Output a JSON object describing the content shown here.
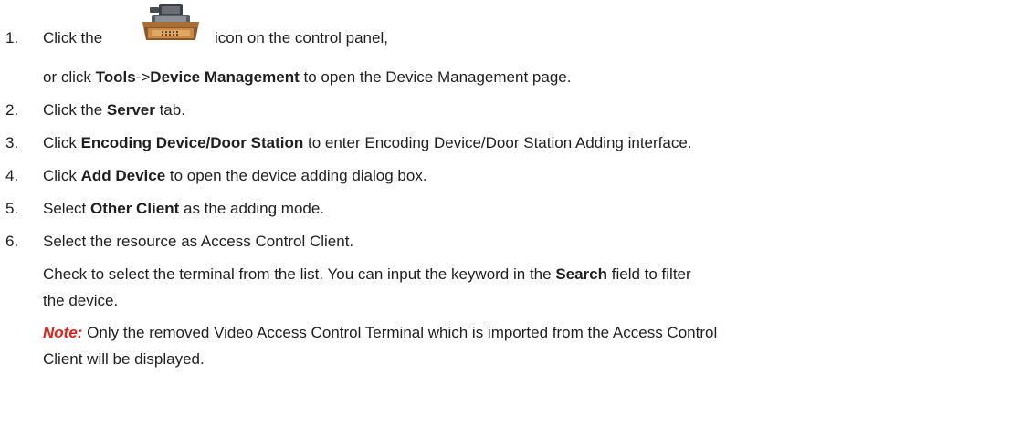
{
  "steps": [
    {
      "num": "1.",
      "pre": "Click the",
      "post": "icon on the control panel,",
      "cont_pre": "or click ",
      "cont_b1": "Tools",
      "cont_mid": "->",
      "cont_b2": "Device Management",
      "cont_post": " to open the Device Management page."
    },
    {
      "num": "2.",
      "pre": "Click the ",
      "bold": "Server",
      "post": " tab."
    },
    {
      "num": "3.",
      "pre": "Click ",
      "bold": "Encoding Device/Door Station",
      "post": " to enter Encoding Device/Door Station Adding interface."
    },
    {
      "num": "4.",
      "pre": "Click ",
      "bold": "Add Device",
      "post": " to open the device adding dialog box."
    },
    {
      "num": "5.",
      "pre": "Select ",
      "bold": "Other Client",
      "post": " as the adding mode."
    },
    {
      "num": "6.",
      "text": "Select the resource as Access Control Client.",
      "cont1_pre": "Check to select the terminal from the list. You can input the keyword in the ",
      "cont1_bold": "Search",
      "cont1_post": " field to filter",
      "cont2": "the device.",
      "note_label": "Note:",
      "note_line1": " Only the removed Video Access Control Terminal which is imported from the Access Control",
      "note_line2": "Client will be displayed."
    }
  ],
  "icon": "device-management-icon"
}
